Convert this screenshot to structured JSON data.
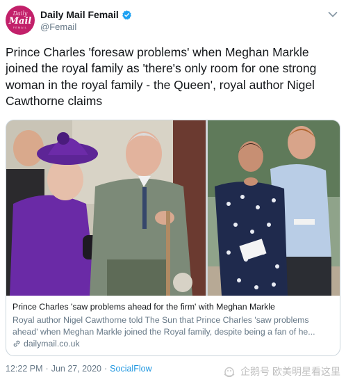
{
  "account": {
    "avatar_line1": "Daily",
    "avatar_line2": "Mail",
    "avatar_line3": "FEMAIL",
    "display_name": "Daily Mail Femail",
    "handle": "@Femail",
    "verified": true
  },
  "tweet": {
    "text": "Prince Charles 'foresaw problems' when Meghan Markle joined the royal family as 'there's only room for one strong woman in the royal family - the Queen', royal author Nigel Cawthorne claims"
  },
  "card": {
    "title": "Prince Charles 'saw problems ahead for the firm' with Meghan Markle",
    "description": "Royal author Nigel Cawthorne told The Sun that Prince Charles 'saw problems ahead' when Meghan Markle joined the Royal family, despite being a fan of he...",
    "domain": "dailymail.co.uk"
  },
  "footer": {
    "time": "12:22 PM",
    "separator": "·",
    "date": "Jun 27, 2020",
    "source": "SocialFlow"
  },
  "watermark": {
    "text": "企鹅号 欧美明星看这里"
  },
  "colors": {
    "brand": "#c2206a",
    "link": "#1b95e0",
    "muted": "#657786",
    "verified": "#1da1f2"
  }
}
